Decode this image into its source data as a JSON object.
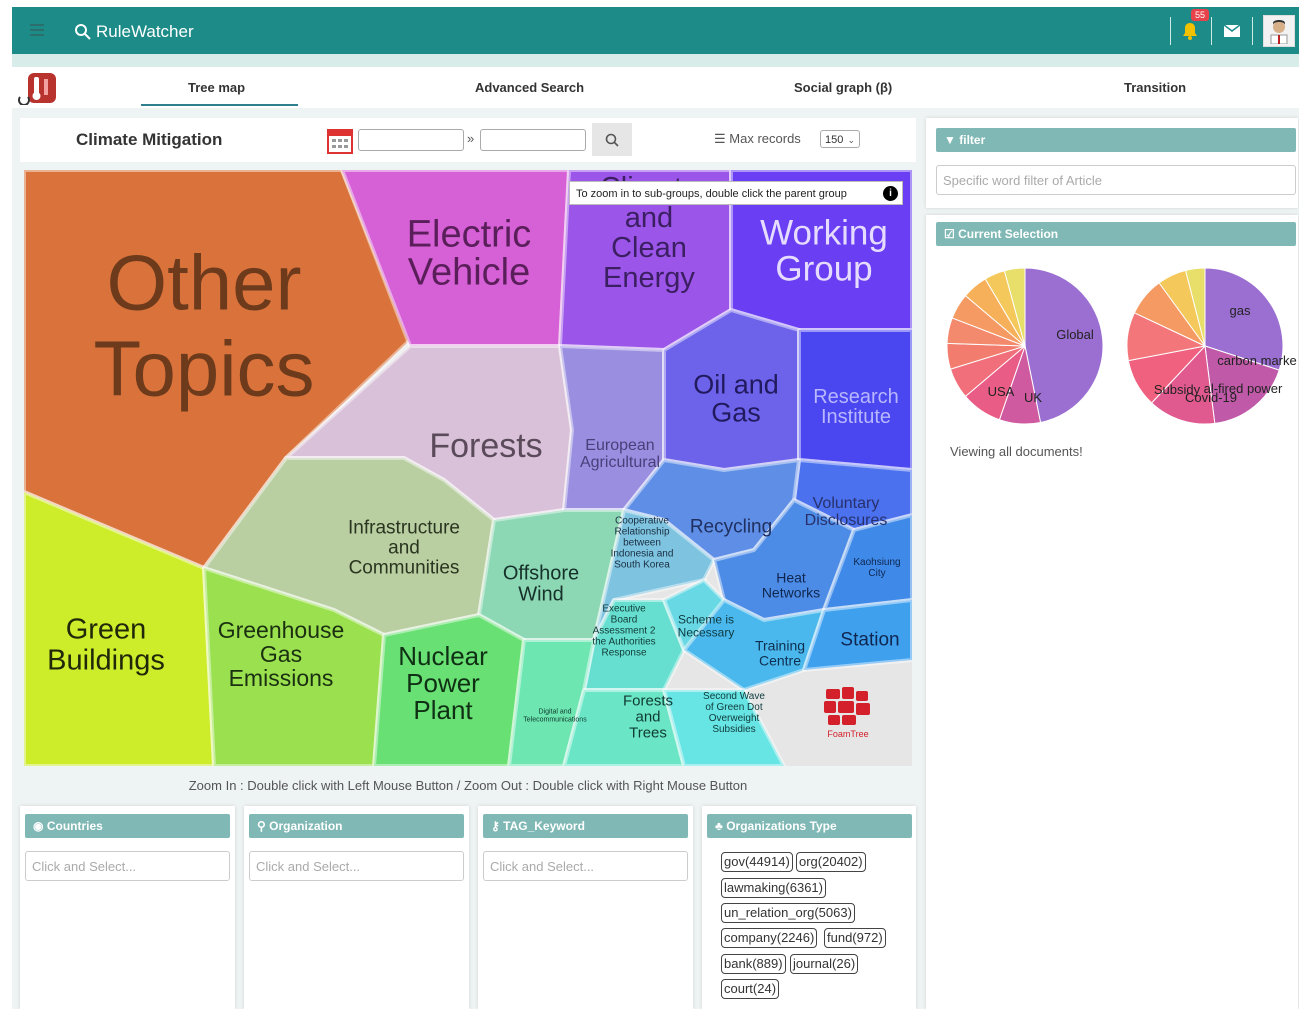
{
  "topbar": {
    "brand": "RuleWatcher",
    "notification_count": "55"
  },
  "tabs": [
    {
      "label": "Tree map",
      "active": true
    },
    {
      "label": "Advanced Search",
      "active": false
    },
    {
      "label": "Social graph (β)",
      "active": false
    },
    {
      "label": "Transition",
      "active": false
    }
  ],
  "main": {
    "title": "Climate Mitigation",
    "date_separator": "»",
    "max_records_label": "Max records",
    "max_records_value": "150",
    "tooltip": "To zoom in to sub-groups, double click the parent group",
    "tooltip_icon": "i",
    "zoom_hint": "Zoom In : Double click with Left Mouse Button / Zoom Out : Double click with Right Mouse Button"
  },
  "treemap": {
    "groups": [
      {
        "label": "Other Topics",
        "color": "#d9733b"
      },
      {
        "label": "Electric Vehicle",
        "color": "#d660d6"
      },
      {
        "label": "Climate and Clean Energy",
        "color": "#9b55e8"
      },
      {
        "label": "Working Group",
        "color": "#6a3ef2"
      },
      {
        "label": "Forests",
        "color": "#d9c2d9"
      },
      {
        "label": "European Agricultural",
        "color": "#9a8ee0"
      },
      {
        "label": "Oil and Gas",
        "color": "#6d63ea"
      },
      {
        "label": "Research Institute",
        "color": "#4a46f0"
      },
      {
        "label": "Voluntary Disclosures",
        "color": "#4b71ee"
      },
      {
        "label": "Recycling",
        "color": "#5f8ee6"
      },
      {
        "label": "Infrastructure and Communities",
        "color": "#b9cfa2"
      },
      {
        "label": "Offshore Wind",
        "color": "#8dd8b4"
      },
      {
        "label": "Cooperative Relationship between Indonesia and South Korea",
        "color": "#7ec3e0"
      },
      {
        "label": "Heat Networks",
        "color": "#4d8ce6"
      },
      {
        "label": "Kaohsiung City",
        "color": "#3f8ae8"
      },
      {
        "label": "Green Buildings",
        "color": "#cdec2a"
      },
      {
        "label": "Greenhouse Gas Emissions",
        "color": "#9ae04f"
      },
      {
        "label": "Nuclear Power Plant",
        "color": "#69e073"
      },
      {
        "label": "Executive Board Assessment 2 the Authorities Response",
        "color": "#67dfd0"
      },
      {
        "label": "Scheme is Necessary",
        "color": "#68d9e4"
      },
      {
        "label": "Training Centre",
        "color": "#4ab8ec"
      },
      {
        "label": "Station",
        "color": "#3fa1ee"
      },
      {
        "label": "Digital and Telecommunications",
        "color": "#6de6b2"
      },
      {
        "label": "Forests and Trees",
        "color": "#6ae6c6"
      },
      {
        "label": "Second Wave of Green Dot Overweight Subsidies",
        "color": "#67e4e4"
      }
    ],
    "foamtree_label": "FoamTree"
  },
  "filter": {
    "header": "filter",
    "placeholder": "Specific word filter of Article"
  },
  "current_selection": {
    "header": "Current Selection",
    "pie1_labels": [
      "Global",
      "USA",
      "UK"
    ],
    "pie2_labels": [
      "gas",
      "carbon marke",
      "Subsidy",
      "al-fired power",
      "Covid-19"
    ],
    "viewing_text": "Viewing all documents!"
  },
  "facets": [
    {
      "header": "Countries",
      "placeholder": "Click and Select..."
    },
    {
      "header": "Organization",
      "placeholder": "Click and Select..."
    },
    {
      "header": "TAG_Keyword",
      "placeholder": "Click and Select..."
    },
    {
      "header": "Organizations Type"
    }
  ],
  "org_types": [
    "gov(44914)",
    "org(20402)",
    "lawmaking(6361)",
    "un_relation_org(5063)",
    "company(2246)",
    "fund(972)",
    "bank(889)",
    "journal(26)",
    "court(24)"
  ]
}
